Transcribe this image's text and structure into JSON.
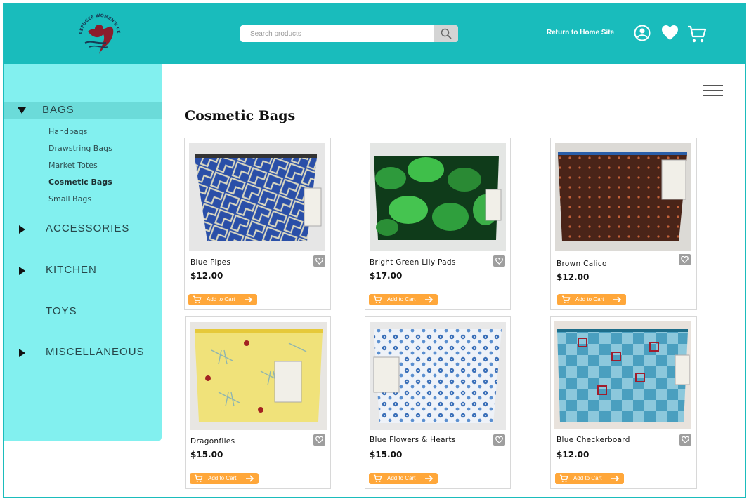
{
  "header": {
    "logo_text": "REFUGEE WOMEN'S CENTER",
    "search_placeholder": "Search products",
    "home_link": "Return to Home Site",
    "icons": [
      "account-icon",
      "heart-icon",
      "cart-icon"
    ],
    "bg_color": "#19bcbc"
  },
  "sidebar": {
    "bg_color": "#82f0ef",
    "categories": [
      {
        "label": "BAGS",
        "expanded": true,
        "has_arrow": true,
        "items": [
          "Handbags",
          "Drawstring Bags",
          "Market Totes",
          "Cosmetic Bags",
          "Small Bags"
        ],
        "current": "Cosmetic Bags"
      },
      {
        "label": "ACCESSORIES",
        "expanded": false,
        "has_arrow": true
      },
      {
        "label": "KITCHEN",
        "expanded": false,
        "has_arrow": true
      },
      {
        "label": "TOYS",
        "expanded": false,
        "has_arrow": false
      },
      {
        "label": "MISCELLANEOUS",
        "expanded": false,
        "has_arrow": true
      }
    ]
  },
  "main": {
    "title": "Cosmetic Bags",
    "add_to_cart_label": "Add to Cart",
    "accent_color": "#ffa73a",
    "products": [
      {
        "name": "Blue Pipes",
        "price": "$12.00"
      },
      {
        "name": "Bright Green Lily Pads",
        "price": "$17.00"
      },
      {
        "name": "Brown Calico",
        "price": "$12.00"
      },
      {
        "name": "Dragonflies",
        "price": "$15.00"
      },
      {
        "name": "Blue Flowers & Hearts",
        "price": "$15.00"
      },
      {
        "name": "Blue Checkerboard",
        "price": "$12.00"
      }
    ]
  }
}
